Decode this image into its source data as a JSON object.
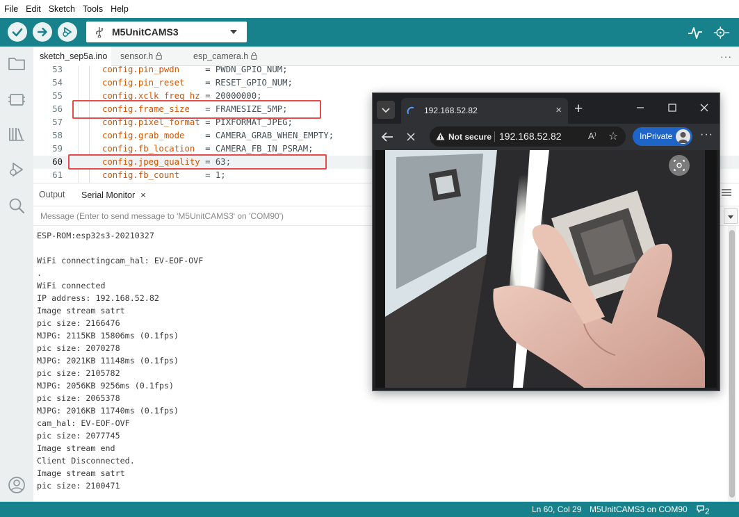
{
  "menu": [
    "File",
    "Edit",
    "Sketch",
    "Tools",
    "Help"
  ],
  "toolbar": {
    "board_name": "M5UnitCAMS3"
  },
  "tabs": [
    {
      "label": "sketch_sep5a.ino",
      "active": true,
      "locked": false
    },
    {
      "label": "sensor.h",
      "active": false,
      "locked": true
    },
    {
      "label": "esp_camera.h",
      "active": false,
      "locked": true
    }
  ],
  "tabs_more": "···",
  "editor": {
    "lines": [
      {
        "num": "53",
        "obj": "config",
        "field": ".pin_pwdn",
        "pad": "     ",
        "value": "= PWDN_GPIO_NUM;"
      },
      {
        "num": "54",
        "obj": "config",
        "field": ".pin_reset",
        "pad": "    ",
        "value": "= RESET_GPIO_NUM;"
      },
      {
        "num": "55",
        "obj": "config",
        "field": ".xclk_freq_hz",
        "pad": " ",
        "value": "= 20000000;"
      },
      {
        "num": "56",
        "obj": "config",
        "field": ".frame_size",
        "pad": "   ",
        "value": "= FRAMESIZE_5MP;"
      },
      {
        "num": "57",
        "obj": "config",
        "field": ".pixel_format",
        "pad": " ",
        "value": "= PIXFORMAT_JPEG;"
      },
      {
        "num": "58",
        "obj": "config",
        "field": ".grab_mode",
        "pad": "    ",
        "value": "= CAMERA_GRAB_WHEN_EMPTY;"
      },
      {
        "num": "59",
        "obj": "config",
        "field": ".fb_location",
        "pad": "  ",
        "value": "= CAMERA_FB_IN_PSRAM;"
      },
      {
        "num": "60",
        "obj": "config",
        "field": ".jpeg_quality",
        "pad": " ",
        "value": "= 63;"
      },
      {
        "num": "61",
        "obj": "config",
        "field": ".fb_count",
        "pad": "     ",
        "value": "= 1;"
      }
    ]
  },
  "panel": {
    "tabs": [
      {
        "label": "Output",
        "active": false
      },
      {
        "label": "Serial Monitor",
        "active": true
      }
    ],
    "close": "×"
  },
  "message": {
    "placeholder": "Message (Enter to send message to 'M5UnitCAMS3' on 'COM90')"
  },
  "serial": {
    "lines": [
      "ESP-ROM:esp32s3-20210327",
      "",
      "WiFi connectingcam_hal: EV-EOF-OVF",
      ".",
      "WiFi connected",
      "IP address: 192.168.52.82",
      "Image stream satrt",
      "pic size: 2166476",
      "MJPG: 2115KB 15806ms (0.1fps)",
      "pic size: 2070278",
      "MJPG: 2021KB 11148ms (0.1fps)",
      "pic size: 2105782",
      "MJPG: 2056KB 9256ms (0.1fps)",
      "pic size: 2065378",
      "MJPG: 2016KB 11740ms (0.1fps)",
      "cam_hal: EV-EOF-OVF",
      "pic size: 2077745",
      "Image stream end",
      "Client Disconnected.",
      "Image stream satrt",
      "pic size: 2100471"
    ]
  },
  "status": {
    "position": "Ln 60, Col 29",
    "board_port": "M5UnitCAMS3 on COM90",
    "notifications": "2"
  },
  "browser": {
    "tab_title": "192.168.52.82",
    "tab_close": "×",
    "new_tab": "+",
    "not_secure": "Not secure",
    "url": "192.168.52.82",
    "read_aloud": "A⁾",
    "inprivate": "InPrivate",
    "more": "···"
  },
  "colors": {
    "toolbar": "#17818c",
    "keyword": "#d35400",
    "highlight_box": "#e64a4a",
    "inprivate": "#1f64c7"
  }
}
